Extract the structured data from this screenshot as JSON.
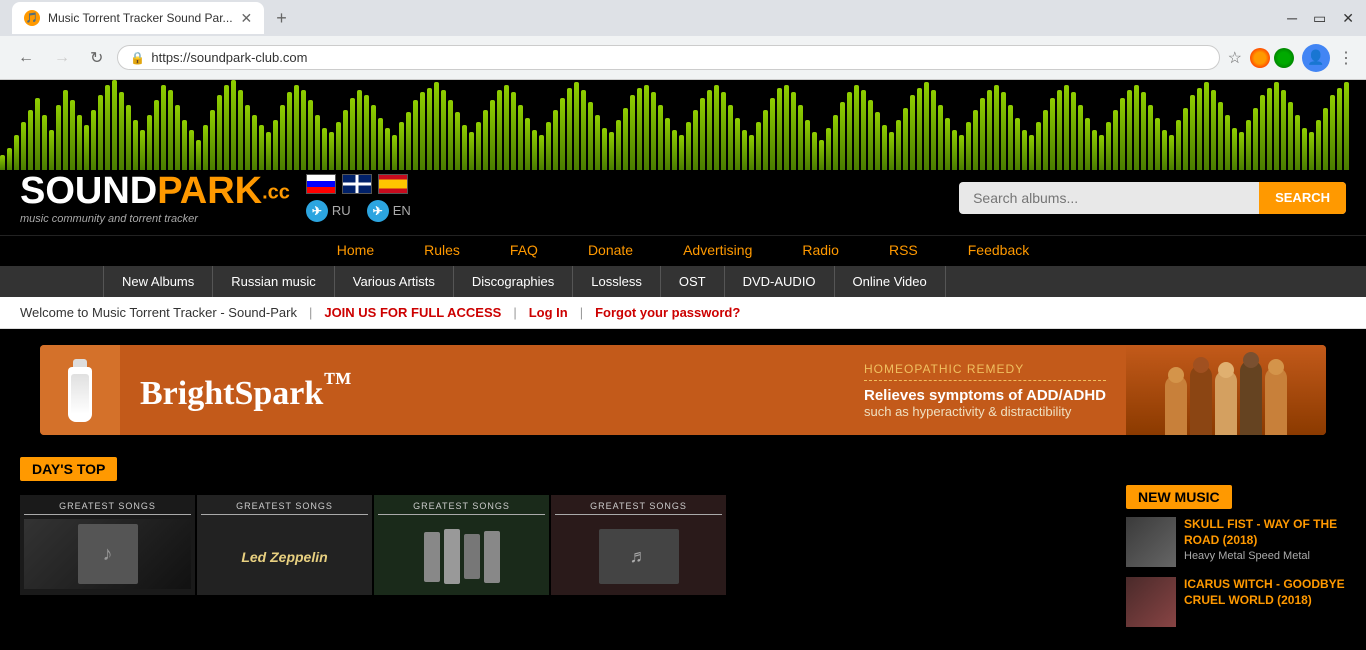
{
  "browser": {
    "tab_title": "Music Torrent Tracker Sound Par...",
    "url": "https://soundpark-club.com",
    "new_tab_label": "+",
    "back_disabled": false,
    "forward_disabled": true
  },
  "site": {
    "logo": {
      "sound": "SOUND",
      "park": "PARK",
      "cc": ".cc",
      "subtitle": "music community and torrent tracker"
    },
    "search": {
      "placeholder": "Search albums...",
      "button_label": "SEARCH"
    },
    "telegram": [
      {
        "lang": "RU",
        "url": "#"
      },
      {
        "lang": "EN",
        "url": "#"
      }
    ],
    "nav": [
      {
        "label": "Home",
        "url": "#"
      },
      {
        "label": "Rules",
        "url": "#"
      },
      {
        "label": "FAQ",
        "url": "#"
      },
      {
        "label": "Donate",
        "url": "#"
      },
      {
        "label": "Advertising",
        "url": "#"
      },
      {
        "label": "Radio",
        "url": "#"
      },
      {
        "label": "RSS",
        "url": "#"
      },
      {
        "label": "Feedback",
        "url": "#"
      }
    ],
    "sub_nav": [
      {
        "label": "New Albums"
      },
      {
        "label": "Russian music"
      },
      {
        "label": "Various Artists"
      },
      {
        "label": "Discographies"
      },
      {
        "label": "Lossless"
      },
      {
        "label": "OST"
      },
      {
        "label": "DVD-AUDIO"
      },
      {
        "label": "Online Video"
      }
    ],
    "welcome": {
      "text": "Welcome to Music Torrent Tracker - Sound-Park",
      "join_label": "JOIN US FOR FULL ACCESS",
      "login_label": "Log In",
      "forgot_label": "Forgot your password?"
    },
    "ad": {
      "brand": "BrightSpark",
      "trademark": "™",
      "homeo_label": "HOMEOPATHIC REMEDY",
      "headline": "Relieves symptoms of ADD/ADHD",
      "sub": "such as hyperactivity & distractibility"
    },
    "sections": {
      "days_top": "DAY'S TOP",
      "new_music": "NEW MUSIC"
    },
    "albums": [
      {
        "label": "GREATEST SONGS",
        "style": "card1"
      },
      {
        "label": "GREATEST SONGS\nLED ZEPPELIN",
        "style": "card2"
      },
      {
        "label": "GREATEST SONGS",
        "style": "card3"
      },
      {
        "label": "GREATEST SONGS",
        "style": "card4"
      }
    ],
    "new_music_items": [
      {
        "title": "SKULL FIST - WAY OF THE ROAD (2018)",
        "tags": "Heavy Metal  Speed Metal",
        "url": "#"
      },
      {
        "title": "ICARUS WITCH - GOODBYE CRUEL WORLD (2018)",
        "tags": "",
        "url": "#"
      }
    ]
  }
}
